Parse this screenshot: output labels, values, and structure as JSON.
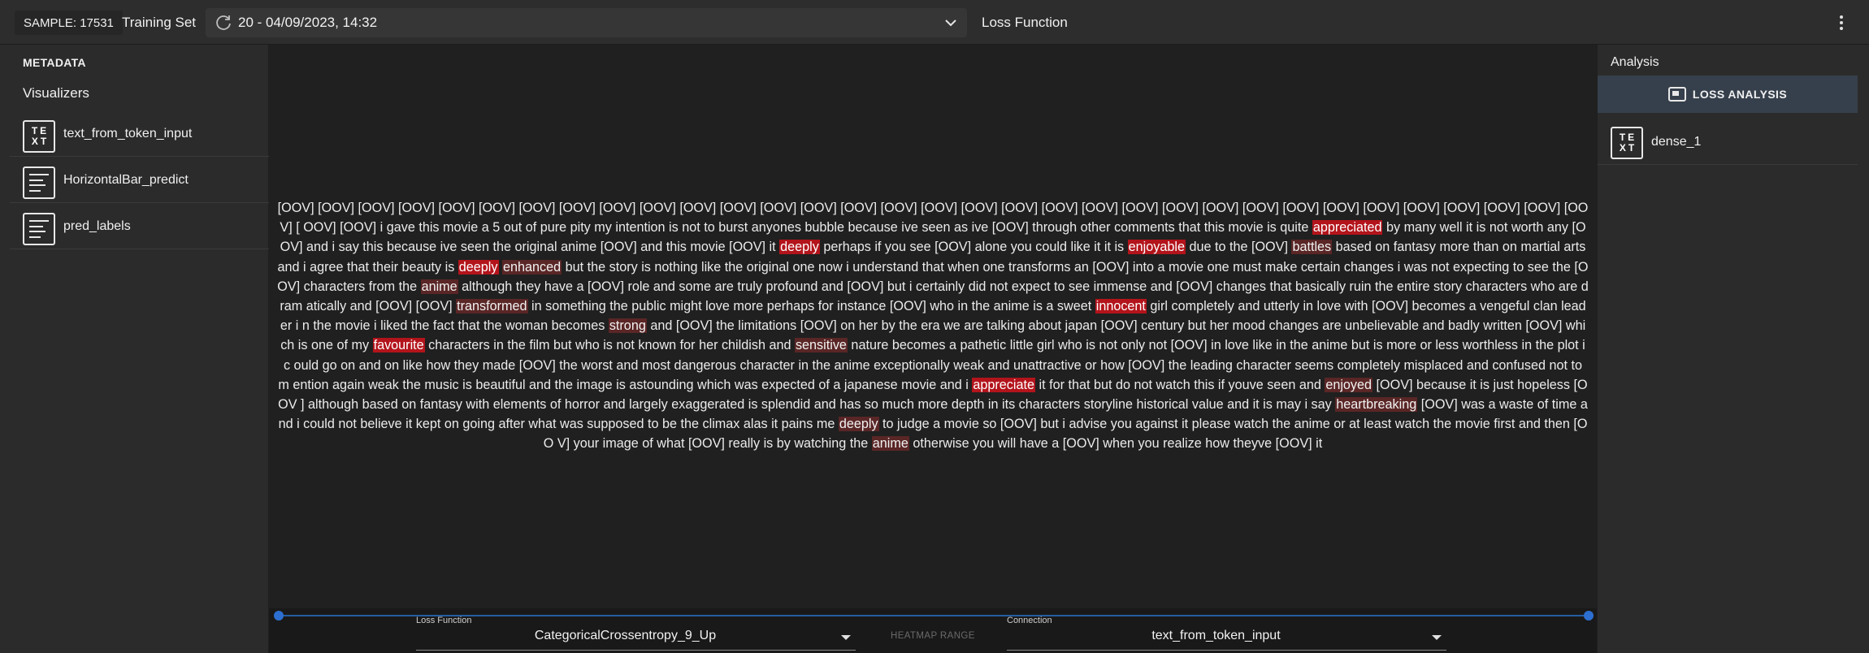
{
  "topbar": {
    "sample_label": "SAMPLE: 17531",
    "dataset_label": "Training Set",
    "epoch_value": "20 - 04/09/2023, 14:32",
    "panel_title": "Loss Function"
  },
  "left_panel": {
    "metadata_label": "METADATA",
    "visualizers_label": "Visualizers",
    "items": [
      {
        "label": "text_from_token_input",
        "icon": "text-icon"
      },
      {
        "label": "HorizontalBar_predict",
        "icon": "lines-icon"
      },
      {
        "label": "pred_labels",
        "icon": "lines-icon"
      }
    ]
  },
  "text_visualization": {
    "segments": [
      {
        "t": "[OOV] [OOV] [OOV] [OOV] [OOV] [OOV] [OOV] [OOV] [OOV] [OOV] [OOV] [OOV] [OOV] [OOV] [OOV] [OOV] [OOV] [OOV] [OOV] [OOV] [OOV] [OOV] [OOV] [OOV] [OOV] [OOV] [OOV] [OOV] [OOV] [OOV] [OOV] [OOV] [OOV] [ OOV] [OOV] i gave this movie a 5 out of pure pity my intention is not to burst anyones bubble because ive seen as ive [OOV] through other comments that this movie is quite "
      },
      {
        "t": "appreciated",
        "h": 2
      },
      {
        "t": " by many well it is not worth any [OOV] and i say this because ive seen the original anime [OOV] and this movie [OOV] it "
      },
      {
        "t": "deeply",
        "h": 2
      },
      {
        "t": " perhaps if you see [OOV] alone you could like it it is "
      },
      {
        "t": "enjoyable",
        "h": 2
      },
      {
        "t": " due to the [OOV] "
      },
      {
        "t": "battles",
        "h": 1
      },
      {
        "t": " based on fantasy more than on martial arts and i agree that their beauty is "
      },
      {
        "t": "deeply",
        "h": 2
      },
      {
        "t": " "
      },
      {
        "t": "enhanced",
        "h": 1
      },
      {
        "t": " but the story is nothing like the original one now i understand that when one transforms an [OOV] into a movie one must make certain changes i was not expecting to see the [OOV] characters from the "
      },
      {
        "t": "anime",
        "h": 1
      },
      {
        "t": " although they have a [OOV] role and some are truly profound and [OOV] but i certainly did not expect to see immense and [OOV] changes that basically ruin the entire story characters who are dram atically and [OOV] [OOV] "
      },
      {
        "t": "transformed",
        "h": 1
      },
      {
        "t": " in something the public might love more perhaps for instance [OOV] who in the anime is a sweet "
      },
      {
        "t": "innocent",
        "h": 2
      },
      {
        "t": " girl completely and utterly in love with [OOV] becomes a vengeful clan leader i n the movie i liked the fact that the woman becomes "
      },
      {
        "t": "strong",
        "h": 1
      },
      {
        "t": " and [OOV] the limitations [OOV] on her by the era we are talking about japan [OOV] century but her mood changes are unbelievable and badly written [OOV] which is one of my "
      },
      {
        "t": "favourite",
        "h": 2
      },
      {
        "t": " characters in the film but who is not known for her childish and "
      },
      {
        "t": "sensitive",
        "h": 1
      },
      {
        "t": " nature becomes a pathetic little girl who is not only not [OOV] in love like in the anime but is more or less worthless in the plot i c ould go on and on like how they made [OOV] the worst and most dangerous character in the anime exceptionally weak and unattractive or how [OOV] the leading character seems completely misplaced and confused not to m ention again weak the music is beautiful and the image is astounding which was expected of a japanese movie and i "
      },
      {
        "t": "appreciate",
        "h": 2
      },
      {
        "t": " it for that but do not watch this if youve seen and "
      },
      {
        "t": "enjoyed",
        "h": 1
      },
      {
        "t": " [OOV] because it is just hopeless [OOV ] although based on fantasy with elements of horror and largely exaggerated is splendid and has so much more depth in its characters storyline historical value and it is may i say "
      },
      {
        "t": "heartbreaking",
        "h": 1
      },
      {
        "t": " [OOV] was a waste of time and i could not believe it kept on going after what was supposed to be the climax alas it pains me "
      },
      {
        "t": "deeply",
        "h": 1
      },
      {
        "t": " to judge a movie so [OOV] but i advise you against it please watch the anime or at least watch the movie first and then [OO V] your image of what [OOV] really is by watching the "
      },
      {
        "t": "anime",
        "h": 1
      },
      {
        "t": " otherwise you will have a [OOV] when you realize how theyve [OOV] it"
      }
    ]
  },
  "bottom_controls": {
    "loss_function_label": "Loss Function",
    "loss_function_value": "CategoricalCrossentropy_9_Up",
    "heatmap_range_label": "HEATMAP RANGE",
    "connection_label": "Connection",
    "connection_value": "text_from_token_input",
    "slider_range": [
      0,
      1
    ]
  },
  "right_panel": {
    "title": "Analysis",
    "tab_label": "LOSS ANALYSIS",
    "items": [
      {
        "label": "dense_1",
        "icon": "text-icon"
      }
    ]
  },
  "colors": {
    "highlight_strong": "#b3141b",
    "highlight_weak": "#5a2626",
    "slider": "#2d6fd0",
    "tab_background": "#36404c"
  }
}
